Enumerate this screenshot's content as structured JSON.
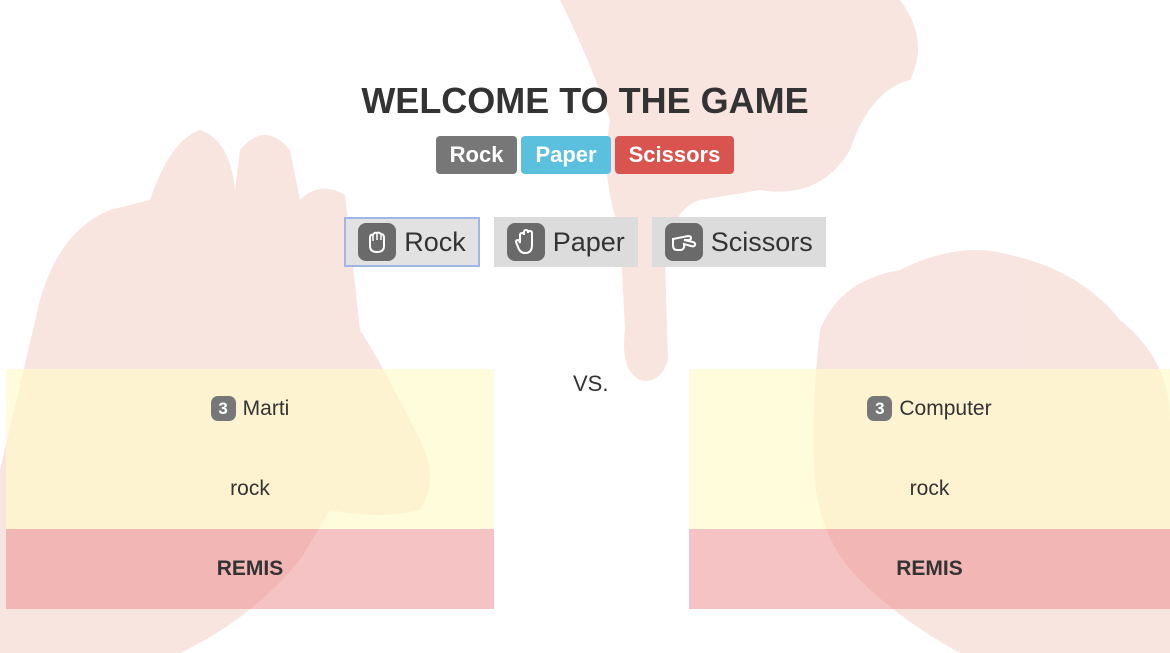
{
  "title": "WELCOME TO THE GAME",
  "legend": [
    {
      "label": "Rock",
      "color": "#777777"
    },
    {
      "label": "Paper",
      "color": "#5bc0de"
    },
    {
      "label": "Scissors",
      "color": "#d9534f"
    }
  ],
  "choices": [
    {
      "label": "Rock",
      "icon": "rock-hand-icon",
      "selected": true
    },
    {
      "label": "Paper",
      "icon": "paper-hand-icon",
      "selected": false
    },
    {
      "label": "Scissors",
      "icon": "scissors-hand-icon",
      "selected": false
    }
  ],
  "vs": "VS.",
  "player": {
    "score": "3",
    "name": "Marti",
    "choice": "rock",
    "result": "REMIS"
  },
  "computer": {
    "score": "3",
    "name": "Computer",
    "choice": "rock",
    "result": "REMIS"
  }
}
